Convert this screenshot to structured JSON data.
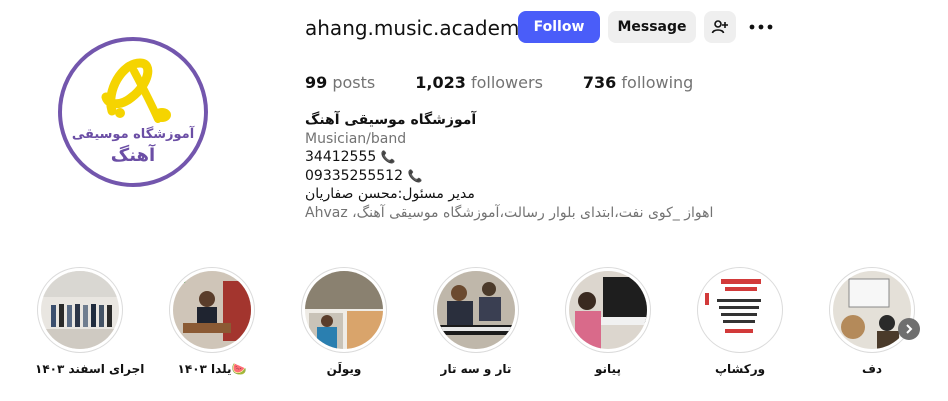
{
  "profile": {
    "username": "ahang.music.academy",
    "logo_text_line1": "آموزشگاه موسیقی",
    "logo_text_line2": "آهنگ"
  },
  "actions": {
    "follow_label": "Follow",
    "message_label": "Message",
    "add_user_icon": "person-add-icon",
    "more_icon": "more-options-icon"
  },
  "stats": {
    "posts_count": "99",
    "posts_label": "posts",
    "followers_count": "1,023",
    "followers_label": "followers",
    "following_count": "736",
    "following_label": "following"
  },
  "bio": {
    "name": "آموزشگاه موسیقی آهنگ",
    "category": "Musician/band",
    "phone1": "34412555",
    "phone2": "09335255512",
    "manager": "مدیر مسئول:محسن صفاریان",
    "address": "اهواز _کوی نفت،ابتدای بلوار رسالت،آموزشگاه موسیقی آهنگ، Ahvaz",
    "phone_icon": "phone-icon"
  },
  "highlights": [
    {
      "label": "اجرای اسفند ۱۴۰۳"
    },
    {
      "label": "یلدا ۱۴۰۳🍉"
    },
    {
      "label": "ویولَن"
    },
    {
      "label": "تار و سه تار"
    },
    {
      "label": "پیانو"
    },
    {
      "label": "ورکشاپ"
    },
    {
      "label": "دف"
    }
  ],
  "colors": {
    "follow_button": "#4a5df9",
    "logo_purple": "#7356ad",
    "logo_yellow": "#f5d400"
  }
}
